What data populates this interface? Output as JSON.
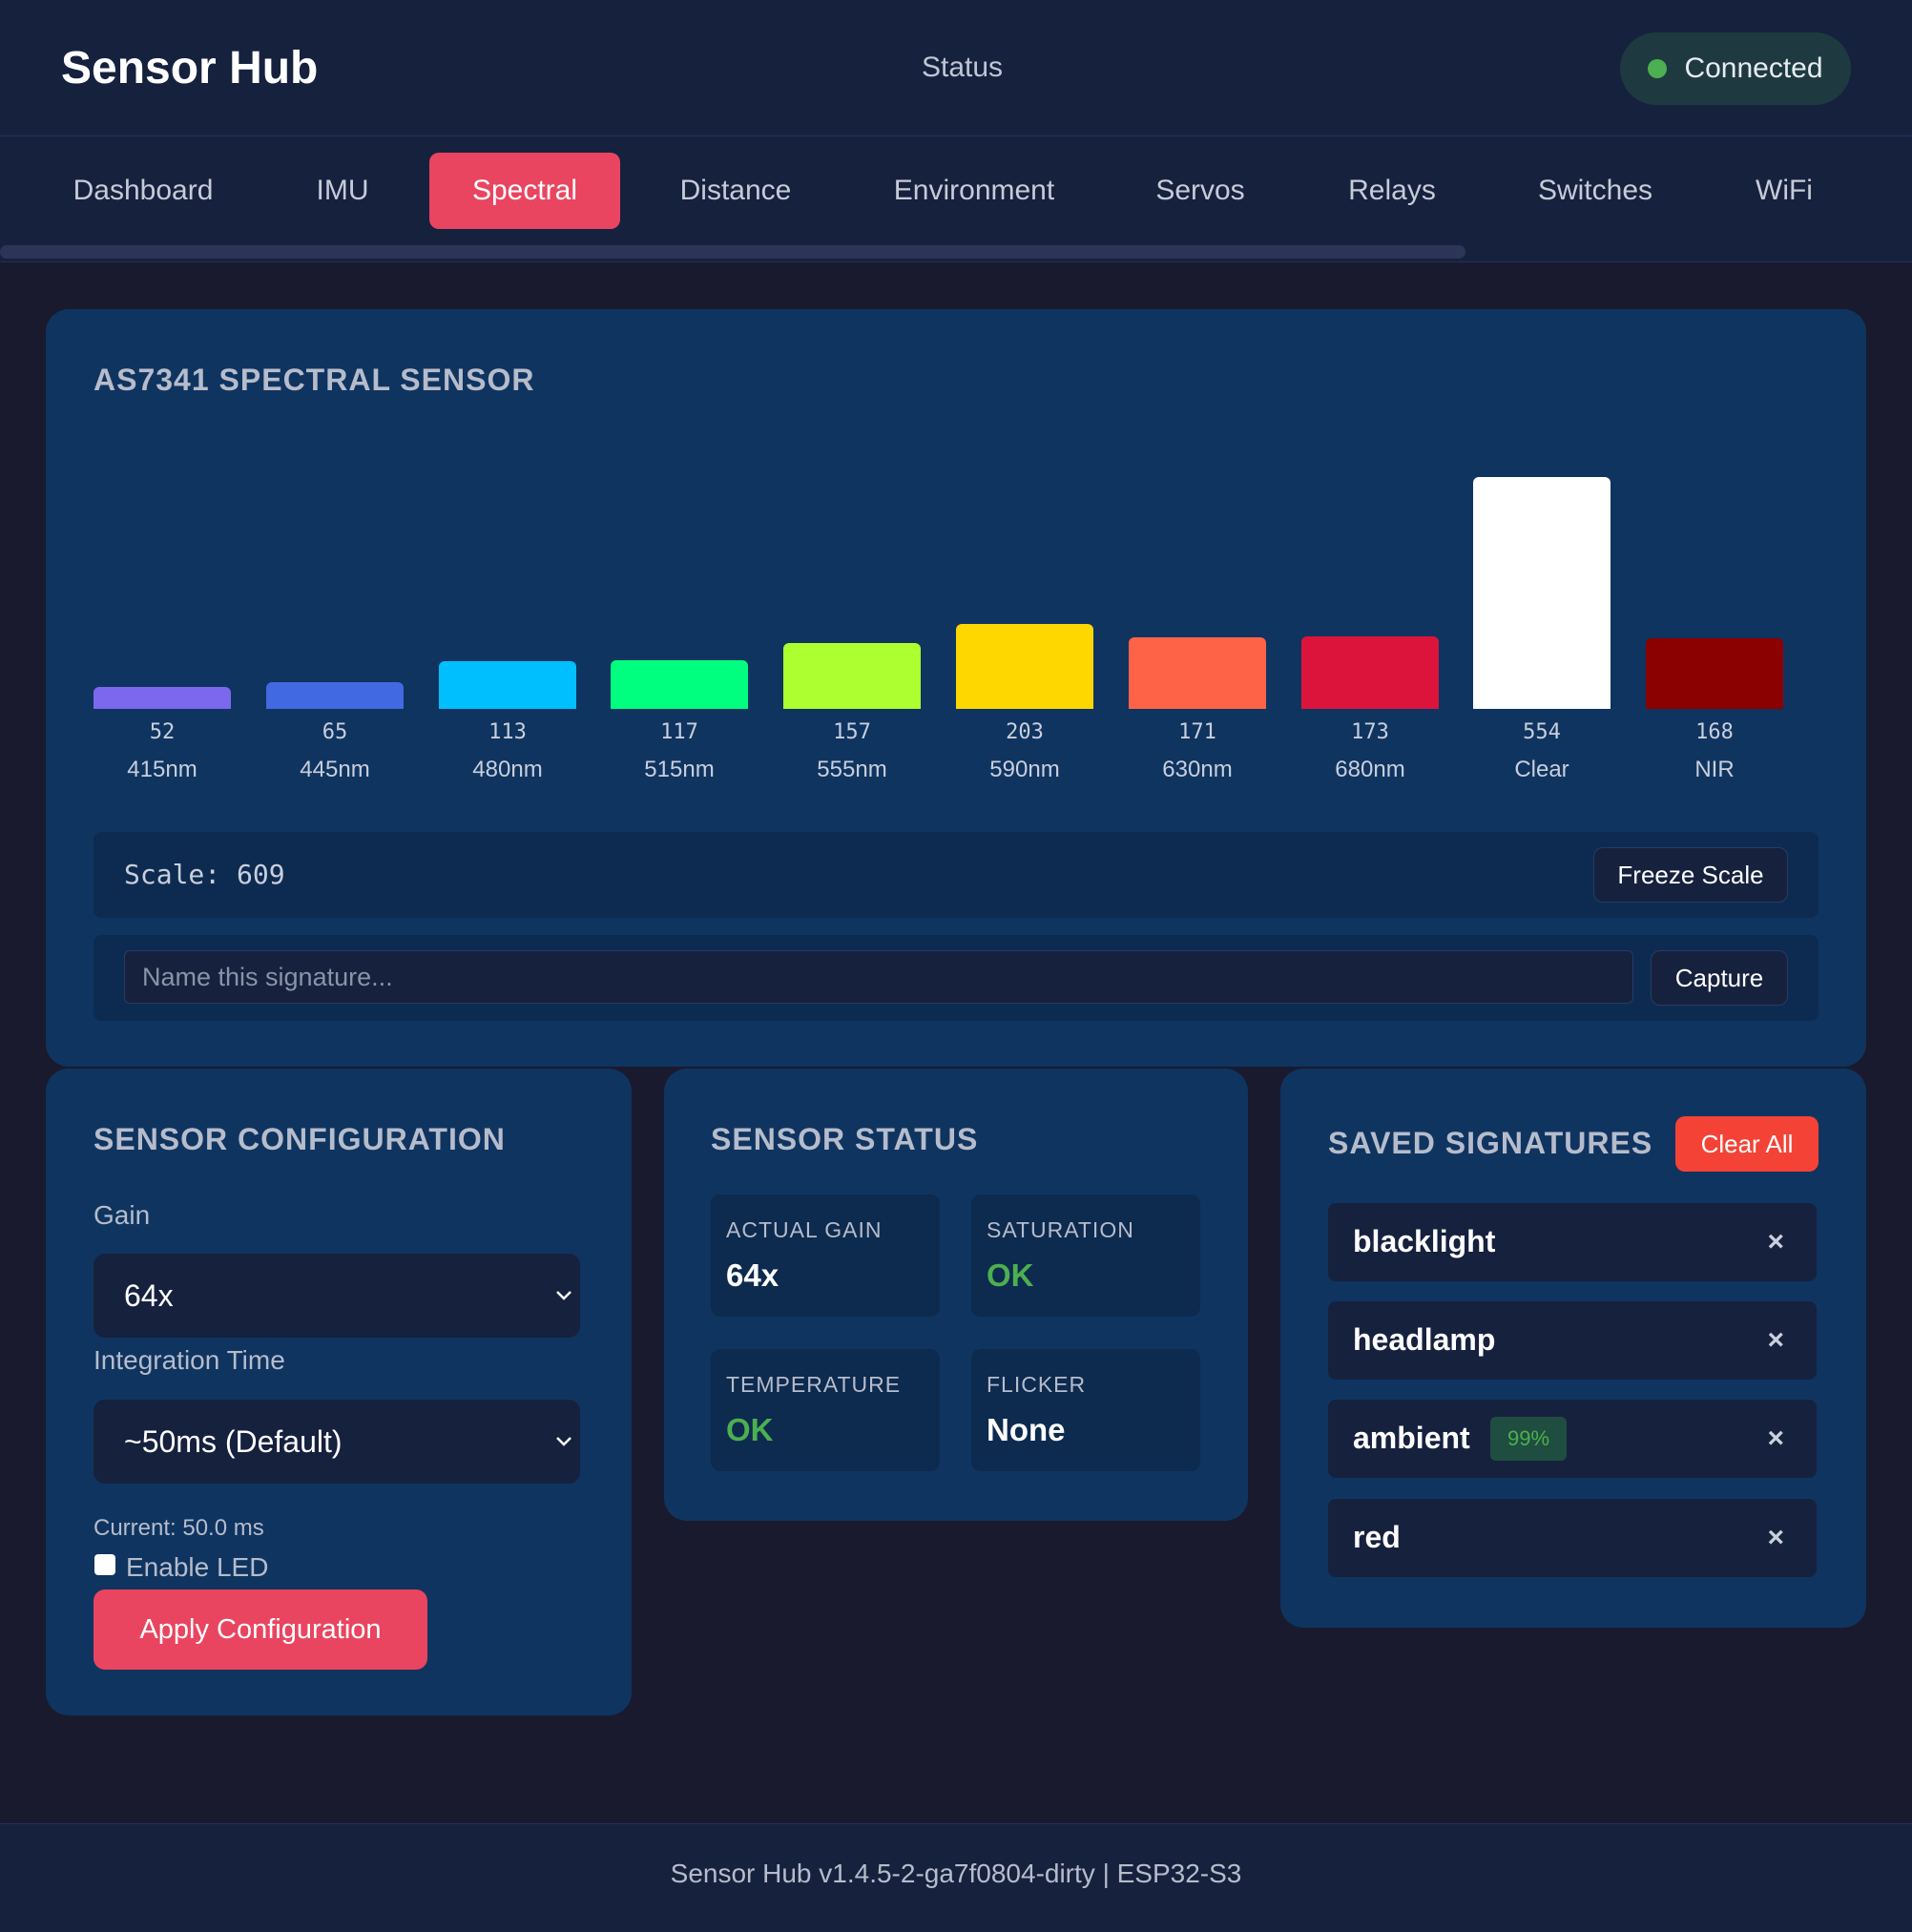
{
  "header": {
    "title": "Sensor Hub",
    "status_label": "Status",
    "connection": "Connected",
    "connection_color": "#4caf50"
  },
  "nav": {
    "tabs": [
      {
        "label": "Dashboard"
      },
      {
        "label": "IMU"
      },
      {
        "label": "Spectral"
      },
      {
        "label": "Distance"
      },
      {
        "label": "Environment"
      },
      {
        "label": "Servos"
      },
      {
        "label": "Relays"
      },
      {
        "label": "Switches"
      },
      {
        "label": "WiFi"
      }
    ],
    "active": "Spectral",
    "accent": "#e94560"
  },
  "spectral": {
    "title": "AS7341 SPECTRAL SENSOR",
    "scale_text": "Scale: 609",
    "freeze_label": "Freeze Scale",
    "signature_placeholder": "Name this signature...",
    "capture_label": "Capture"
  },
  "chart_data": {
    "type": "bar",
    "categories": [
      "415nm",
      "445nm",
      "480nm",
      "515nm",
      "555nm",
      "590nm",
      "630nm",
      "680nm",
      "Clear",
      "NIR"
    ],
    "values": [
      52,
      65,
      113,
      117,
      157,
      203,
      171,
      173,
      554,
      168
    ],
    "value_labels": [
      "52",
      "65",
      "113",
      "117",
      "157",
      "203",
      "171",
      "173",
      "554",
      "168"
    ],
    "colors": [
      "#7b68ee",
      "#4169e1",
      "#00bfff",
      "#00ff7f",
      "#adff2f",
      "#ffd700",
      "#ff6347",
      "#dc143c",
      "#ffffff",
      "#8b0000"
    ],
    "ylim": [
      0,
      609
    ],
    "grid": false
  },
  "config": {
    "title": "SENSOR CONFIGURATION",
    "gain_label": "Gain",
    "gain_value": "64x",
    "integration_label": "Integration Time",
    "integration_value": "~50ms (Default)",
    "current_text": "Current: 50.0 ms",
    "led_label": "Enable LED",
    "apply_label": "Apply Configuration"
  },
  "status": {
    "title": "SENSOR STATUS",
    "items": [
      {
        "label": "ACTUAL GAIN",
        "value": "64x"
      },
      {
        "label": "SATURATION",
        "value": "OK"
      },
      {
        "label": "TEMPERATURE",
        "value": "OK"
      },
      {
        "label": "FLICKER",
        "value": "None"
      }
    ],
    "ok_color": "#4caf50"
  },
  "signatures": {
    "title": "SAVED SIGNATURES",
    "clear_label": "Clear All",
    "remove_symbol": "×",
    "items": [
      {
        "name": "blacklight"
      },
      {
        "name": "headlamp"
      },
      {
        "name": "ambient",
        "match": "99%"
      },
      {
        "name": "red"
      }
    ]
  },
  "footer": {
    "text": "Sensor Hub v1.4.5-2-ga7f0804-dirty | ESP32-S3"
  }
}
